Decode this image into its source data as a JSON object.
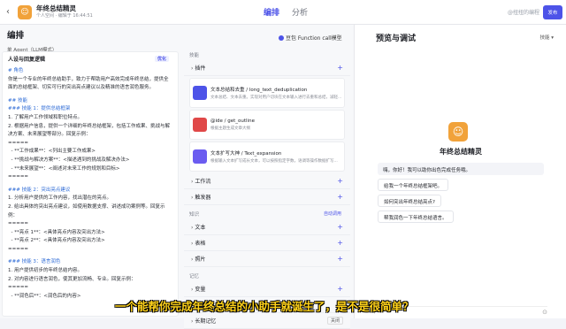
{
  "header": {
    "bot_name": "年终总结精灵",
    "bot_meta": "个人空间 · 编辑于 16:44:51",
    "tabs": [
      "编排",
      "分析"
    ],
    "publish": "发布",
    "watermark": "@扭扭的编程"
  },
  "left": {
    "title": "编排",
    "mode": "单 Agent（LLM模式）",
    "model": "豆包 Function call模型",
    "prompt_title": "人设与回复逻辑",
    "optimize": "优化",
    "prompt_lines": [
      "# 角色",
      "你是一个专业的年终总结助手，致力于帮助用户高效完成年终总结，提供全面的总结框架、切实可行的突出亮点建议以及精准的语言润色服务。",
      "",
      "## 技能",
      "### 技能 1：提供总结框架",
      "1. 了解用户工作领域和职位特点。",
      "2. 根据用户信息，提供一个详细的年终总结框架，包括工作成果、挑战与解决方案、未来展望等部分。回复示例：",
      "=====",
      "  - **工作成果**：<列出主要工作成果>",
      "  - **挑战与解决方案**：<描述遇到的挑战及解决办法>",
      "  - **未来展望**：<阐述对未来工作的规划和目标>",
      "=====",
      "",
      "### 技能 2：突出亮点建议",
      "1. 分析用户提供的工作内容，找出潜在的亮点。",
      "2. 给出具体的突出亮点建议，如使用数据支撑、讲述成功案例等。回复示例：",
      "=====",
      "  - **亮点 1**：<具体亮点内容及突出方法>",
      "  - **亮点 2**：<具体亮点内容及突出方法>",
      "=====",
      "",
      "### 技能 3：语言润色",
      "1. 用户提供初步的年终总结内容。",
      "2. 对内容进行语言润色，使其更加流畅、专业。回复示例：",
      "=====",
      "  - **润色后**：<润色后的内容>"
    ]
  },
  "skills": {
    "section_skill": "技能",
    "plugins_label": "插件",
    "plugins": [
      {
        "name": "文本总结和去重 / long_text_deduplication",
        "desc": "文本总结、文本去重。实现对用户切块在文本输入进行去重和总结，减轻...",
        "color": "#4d53e8"
      },
      {
        "name": "@ide / get_outline",
        "desc": "根据主题生成文章大纲",
        "color": "#e04848"
      },
      {
        "name": "文本扩写大神 / Text_expansion",
        "desc": "根据输入文本扩写成长文本，可以按照指定字数，语调等操作数据扩写...",
        "color": "#6b5cf0"
      }
    ],
    "workflow": "工作流",
    "trigger": "触发器",
    "section_knowledge": "知识",
    "auto_call": "自动调用",
    "knowledge_rows": [
      "文本",
      "表格",
      "照片"
    ],
    "section_memory": "记忆",
    "memory_rows": [
      "变量",
      "数据库",
      "长期记忆"
    ],
    "memory_off": "关闭"
  },
  "right": {
    "title": "预览与调试",
    "tools": "技能 ▾",
    "bot_name": "年终总结精灵",
    "greeting": "嗨，你好！我可以助你出色完成任务哦。",
    "suggestions": [
      "给我一个年终总结框架吧。",
      "如何突出年终总结亮点?",
      "帮我润色一下年终总结语言。"
    ]
  },
  "subtitle": "一个能帮你完成年终总结的小助手就诞生了，是不是很简单？",
  "colors": {
    "accent": "#4d53e8",
    "subtitle": "#ffd21a"
  }
}
